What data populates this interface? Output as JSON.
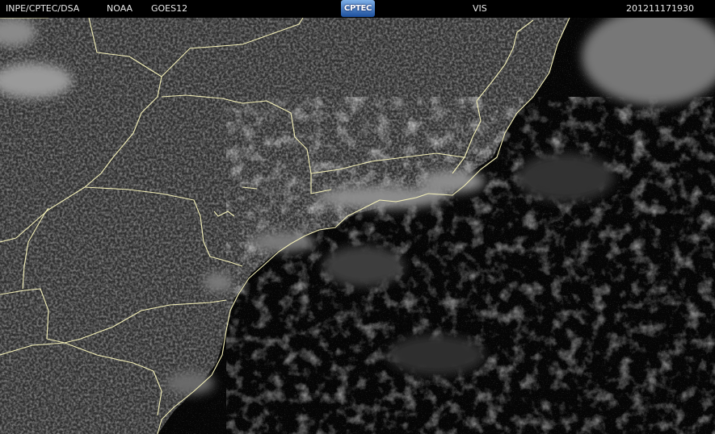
{
  "header": {
    "institution": "INPE/CPTEC/DSA",
    "agency": "NOAA",
    "satellite": "GOES12",
    "logo_text": "CPTEC",
    "channel": "VIS",
    "timestamp": "201211171930"
  },
  "colors": {
    "background": "#000000",
    "header_text": "#e8e8e8",
    "coastline": "#f4f0b8",
    "logo_top": "#7fb0e8",
    "logo_bottom": "#1c4f9c"
  },
  "icons": {
    "logo": "cptec-logo"
  }
}
